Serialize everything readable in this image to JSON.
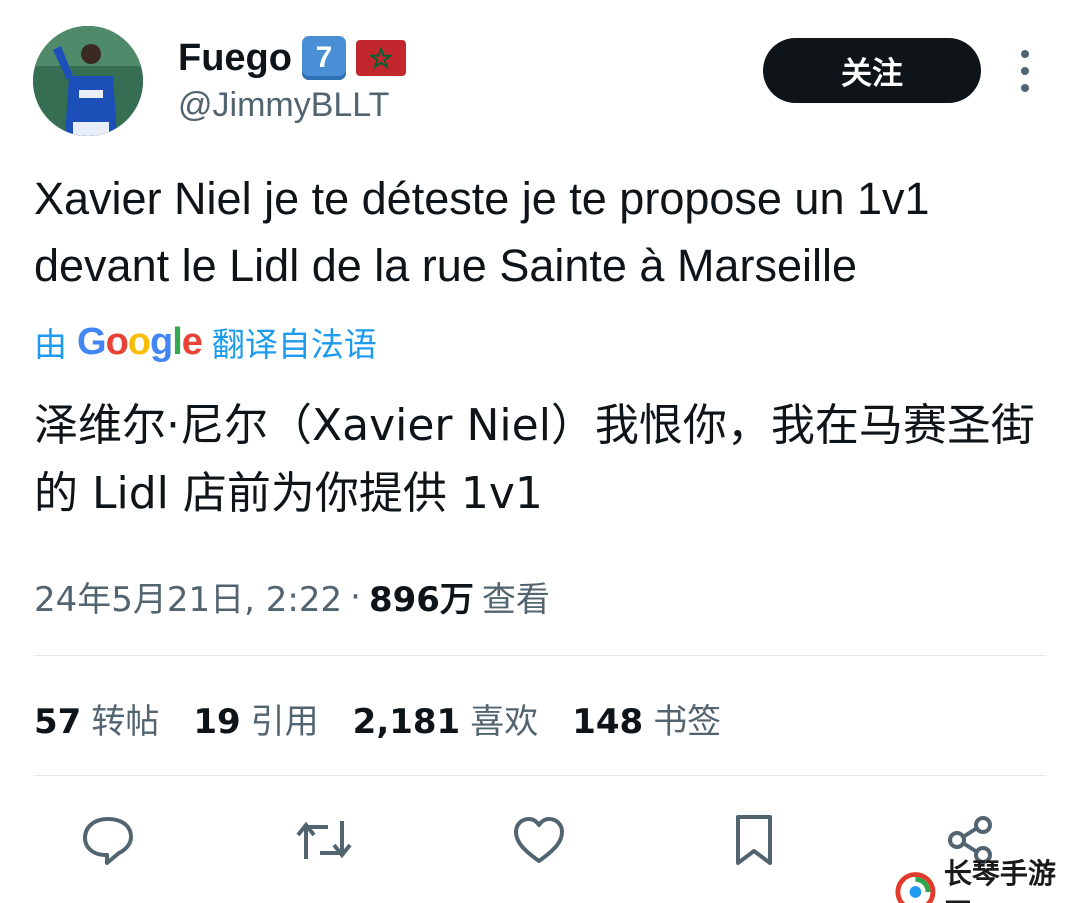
{
  "user": {
    "display_name": "Fuego",
    "badge_keycap": "7",
    "handle": "@JimmyBLLT",
    "follow_label": "关注"
  },
  "tweet": {
    "text": "Xavier Niel je te déteste je te propose un 1v1\ndevant le Lidl de la rue Sainte à Marseille",
    "translated_prefix": "由",
    "translated_brand": "Google",
    "translated_suffix": "翻译自法语",
    "translation": "泽维尔·尼尔（Xavier Niel）我恨你，我在马赛圣街的 Lidl 店前为你提供 1v1",
    "timestamp": "24年5月21日, 2:22",
    "separator": "·",
    "views_count": "896万",
    "views_label": "查看"
  },
  "stats": {
    "retweets_count": "57",
    "retweets_label": "转帖",
    "quotes_count": "19",
    "quotes_label": "引用",
    "likes_count": "2,181",
    "likes_label": "喜欢",
    "bookmarks_count": "148",
    "bookmarks_label": "书签"
  },
  "actions": [
    "reply-icon",
    "retweet-icon",
    "like-icon",
    "bookmark-icon",
    "share-icon"
  ],
  "watermark": {
    "text": "长琴手游网"
  },
  "colors": {
    "accent": "#1d9bf0",
    "text": "#0f1419",
    "muted": "#536471",
    "divider": "#e6e9eb"
  }
}
